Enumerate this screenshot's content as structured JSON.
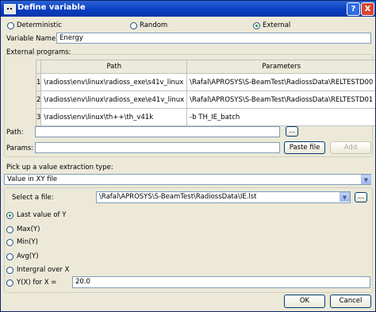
{
  "window": {
    "title": "Define variable",
    "help_label": "?",
    "close_label": "X"
  },
  "type_options": [
    {
      "label": "Deterministic",
      "selected": false
    },
    {
      "label": "Random",
      "selected": false
    },
    {
      "label": "External",
      "selected": true
    }
  ],
  "variable_name": {
    "label": "Variable Name:",
    "value": "Energy"
  },
  "external_programs": {
    "label": "External programs:",
    "columns": [
      "Path",
      "Parameters"
    ],
    "rows": [
      {
        "num": "1",
        "path": "\\radioss\\env\\linux\\radioss_exe\\s41v_linux",
        "params": "\\Rafal\\APROSYS\\S-BeamTest\\RadiossData\\RELTESTD00"
      },
      {
        "num": "2",
        "path": "\\radioss\\env\\linux\\radioss_exe\\e41v_linux",
        "params": "\\Rafal\\APROSYS\\S-BeamTest\\RadiossData\\RELTESTD01"
      },
      {
        "num": "3",
        "path": "\\radioss\\env\\linux\\th++\\th_v41k",
        "params": "-b TH_IE_batch"
      }
    ]
  },
  "path_field": {
    "label": "Path:",
    "value": "",
    "browse_label": "..."
  },
  "params_field": {
    "label": "Params:",
    "value": "",
    "paste_label": "Paste file",
    "add_label": "Add"
  },
  "extraction": {
    "label": "Pick up a value extraction type:",
    "selected": "Value in XY file"
  },
  "file_select": {
    "label": "Select a file:",
    "value": "\\Rafal\\APROSYS\\S-BeamTest\\RadiossData\\IE.lst",
    "browse_label": "..."
  },
  "value_options": [
    {
      "label": "Last value of Y",
      "selected": true
    },
    {
      "label": "Max(Y)",
      "selected": false
    },
    {
      "label": "Min(Y)",
      "selected": false
    },
    {
      "label": "Avg(Y)",
      "selected": false
    },
    {
      "label": "Intergral over X",
      "selected": false
    },
    {
      "label": "Y(X) for X =",
      "selected": false
    }
  ],
  "x_value": "20.0",
  "footer": {
    "ok_label": "OK",
    "cancel_label": "Cancel"
  }
}
